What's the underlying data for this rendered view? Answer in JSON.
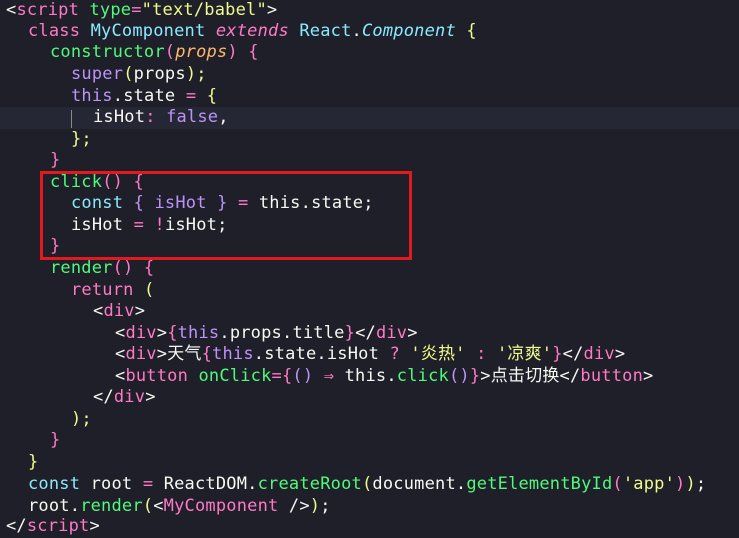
{
  "editor": {
    "language": "html-jsx",
    "theme": "dark",
    "highlight_box_color": "#e3191e",
    "code": {
      "l1": {
        "open": "<",
        "tag": "script",
        "attr": "type",
        "eq": "=",
        "val": "\"text/babel\"",
        "close": ">"
      },
      "l2": {
        "kw": "class",
        "name": "MyComponent",
        "ext": "extends",
        "base1": "React",
        "dot": ".",
        "base2": "Component",
        "brace": "{"
      },
      "l3": {
        "fn": "constructor",
        "paren_open": "(",
        "param": "props",
        "paren_close": ")",
        "brace": "{"
      },
      "l4": {
        "fn": "super",
        "paren_open": "(",
        "arg": "props",
        "rest": ");"
      },
      "l5": {
        "obj": "this",
        "dot": ".",
        "prop": "state",
        "eq": "=",
        "brace": "{"
      },
      "l6": {
        "key": "isHot",
        "colon": ":",
        "val": "false",
        "comma": ","
      },
      "l7": {
        "text": "};"
      },
      "l8": {
        "text": "}"
      },
      "l9": {
        "fn": "click",
        "parens": "()",
        "brace": "{"
      },
      "l10": {
        "kw": "const",
        "brace_open": "{",
        "var": "isHot",
        "brace_close": "}",
        "eq": "=",
        "obj": "this",
        "dot": ".",
        "prop": "state",
        "semi": ";"
      },
      "l11": {
        "var": "isHot",
        "eq": "=",
        "not": "!",
        "var2": "isHot",
        "semi": ";"
      },
      "l12": {
        "text": "}"
      },
      "l13": {
        "fn": "render",
        "parens": "()",
        "brace": "{"
      },
      "l14": {
        "kw": "return",
        "paren": "("
      },
      "l15": {
        "open": "<",
        "tag": "div",
        "close": ">"
      },
      "l16": {
        "open": "<",
        "tag": "div",
        "close": ">",
        "ex_open": "{",
        "obj": "this",
        "dot1": ".",
        "p1": "props",
        "dot2": ".",
        "p2": "title",
        "ex_close": "}",
        "end_open": "</",
        "end_tag": "div",
        "end_close": ">"
      },
      "l17": {
        "open": "<",
        "tag": "div",
        "close": ">",
        "label": "天气",
        "ex_open": "{",
        "obj": "this",
        "dot1": ".",
        "p1": "state",
        "dot2": ".",
        "p2": "isHot",
        "q": "?",
        "s1": "'炎热'",
        "colon": ":",
        "s2": "'凉爽'",
        "ex_close": "}",
        "end_open": "</",
        "end_tag": "div",
        "end_close": ">"
      },
      "l18": {
        "open": "<",
        "tag": "button",
        "attr": "onClick",
        "eq": "=",
        "ex_open": "{",
        "parens": "()",
        "arrow": "⇒",
        "obj": "this",
        "dot": ".",
        "fn": "click",
        "call": "()",
        "ex_close": "}",
        "close": ">",
        "label": "点击切换",
        "end_open": "</",
        "end_tag": "button",
        "end_close": ">"
      },
      "l19": {
        "open": "</",
        "tag": "div",
        "close": ">"
      },
      "l20": {
        "text": ");"
      },
      "l21": {
        "text": "}"
      },
      "l22": {
        "text": "}"
      },
      "l23": {
        "kw": "const",
        "var": "root",
        "eq": "=",
        "obj": "ReactDOM",
        "dot": ".",
        "fn": "createRoot",
        "p_open": "(",
        "doc": "document",
        "dot2": ".",
        "fn2": "getElementById",
        "p2_open": "(",
        "str": "'app'",
        "p2_close": ")",
        "p_close": ")",
        "semi": ";"
      },
      "l24": {
        "var": "root",
        "dot": ".",
        "fn": "render",
        "p_open": "(",
        "open": "<",
        "tag": "MyComponent",
        "selfclose": "/>",
        "p_close": ")",
        "semi": ";"
      },
      "l25": {
        "open": "</",
        "tag": "script",
        "close": ">"
      }
    }
  }
}
